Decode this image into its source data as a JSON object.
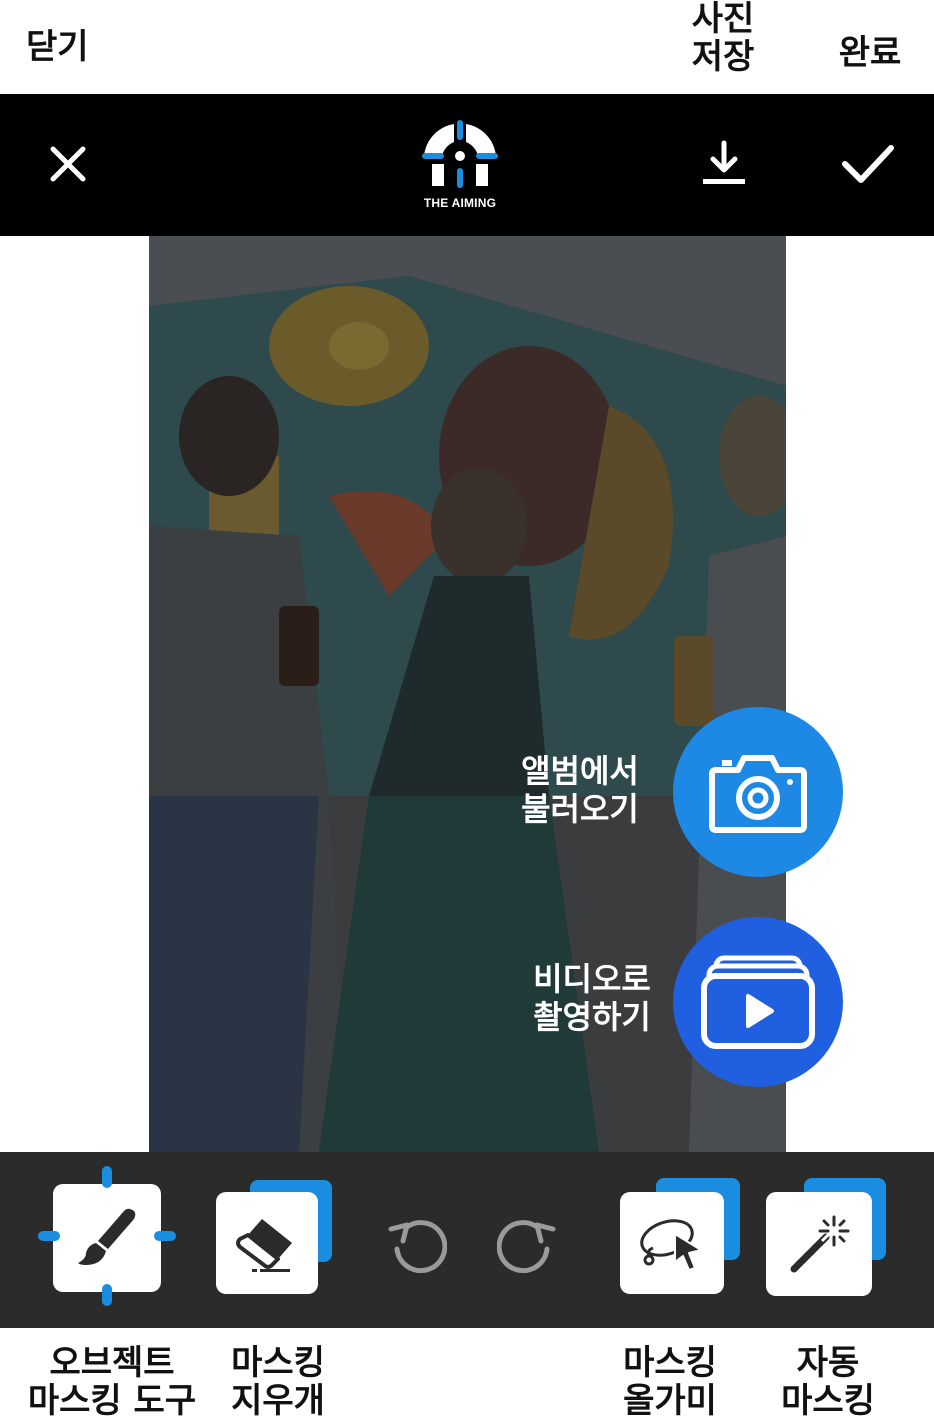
{
  "annotations": {
    "close": "닫기",
    "save_photo": [
      "사진",
      "저장"
    ],
    "done": "완료",
    "object_masking_tool": [
      "오브젝트",
      "마스킹 도구"
    ],
    "masking_eraser": [
      "마스킹",
      "지우개"
    ],
    "masking_lasso": [
      "마스킹",
      "올가미"
    ],
    "auto_masking": [
      "자동",
      "마스킹"
    ]
  },
  "header": {
    "logo_text": "THE AIMING",
    "close_icon": "close-icon",
    "download_icon": "download-icon",
    "check_icon": "check-icon"
  },
  "actions": {
    "load_from_album": [
      "앨범에서",
      "불러오기"
    ],
    "record_video": [
      "비디오로",
      "촬영하기"
    ]
  },
  "toolbar": {
    "tools": [
      "brush-icon",
      "eraser-icon",
      "undo-icon",
      "redo-icon",
      "lasso-icon",
      "magic-wand-icon"
    ]
  },
  "colors": {
    "accent_blue": "#1a8de0",
    "album_button": "#1e88e5",
    "video_button": "#1f5fe0",
    "topbar": "#000000",
    "bottombar": "#2b2b2b"
  }
}
